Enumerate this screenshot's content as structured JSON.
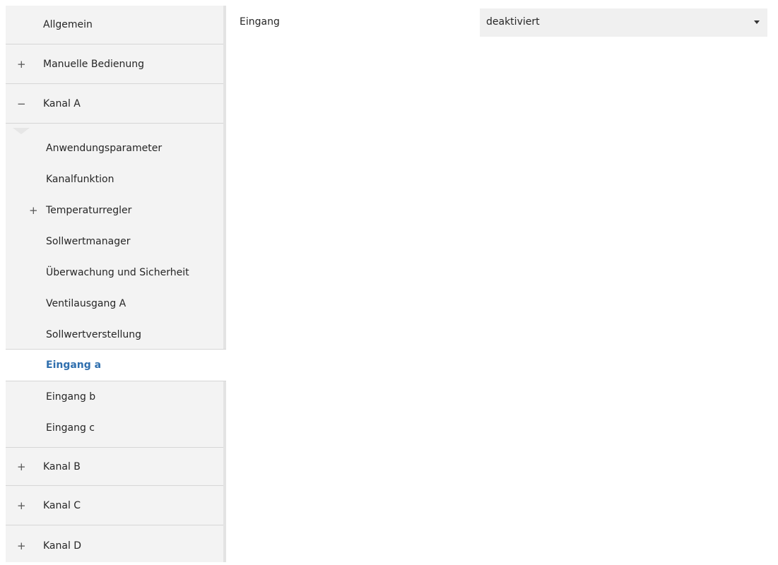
{
  "sidebar": {
    "allgemein": "Allgemein",
    "manuelle_bedienung": {
      "label": "Manuelle Bedienung",
      "expander": "+"
    },
    "kanal_a": {
      "label": "Kanal A",
      "expander": "−",
      "children": [
        {
          "label": "Anwendungsparameter"
        },
        {
          "label": "Kanalfunktion"
        },
        {
          "label": "Temperaturregler",
          "expander": "+"
        },
        {
          "label": "Sollwertmanager"
        },
        {
          "label": "Überwachung und Sicherheit"
        },
        {
          "label": "Ventilausgang A"
        },
        {
          "label": "Sollwertverstellung"
        },
        {
          "label": "Eingang a",
          "selected": true
        },
        {
          "label": "Eingang b"
        },
        {
          "label": "Eingang c"
        }
      ]
    },
    "kanal_b": {
      "label": "Kanal B",
      "expander": "+"
    },
    "kanal_c": {
      "label": "Kanal C",
      "expander": "+"
    },
    "kanal_d": {
      "label": "Kanal D",
      "expander": "+"
    }
  },
  "main": {
    "parameter": {
      "label": "Eingang",
      "value": "deaktiviert"
    }
  },
  "colors": {
    "sidebar_bg": "#f3f3f3",
    "selected_text": "#2f6fae",
    "select_bg": "#f0f0f0"
  }
}
